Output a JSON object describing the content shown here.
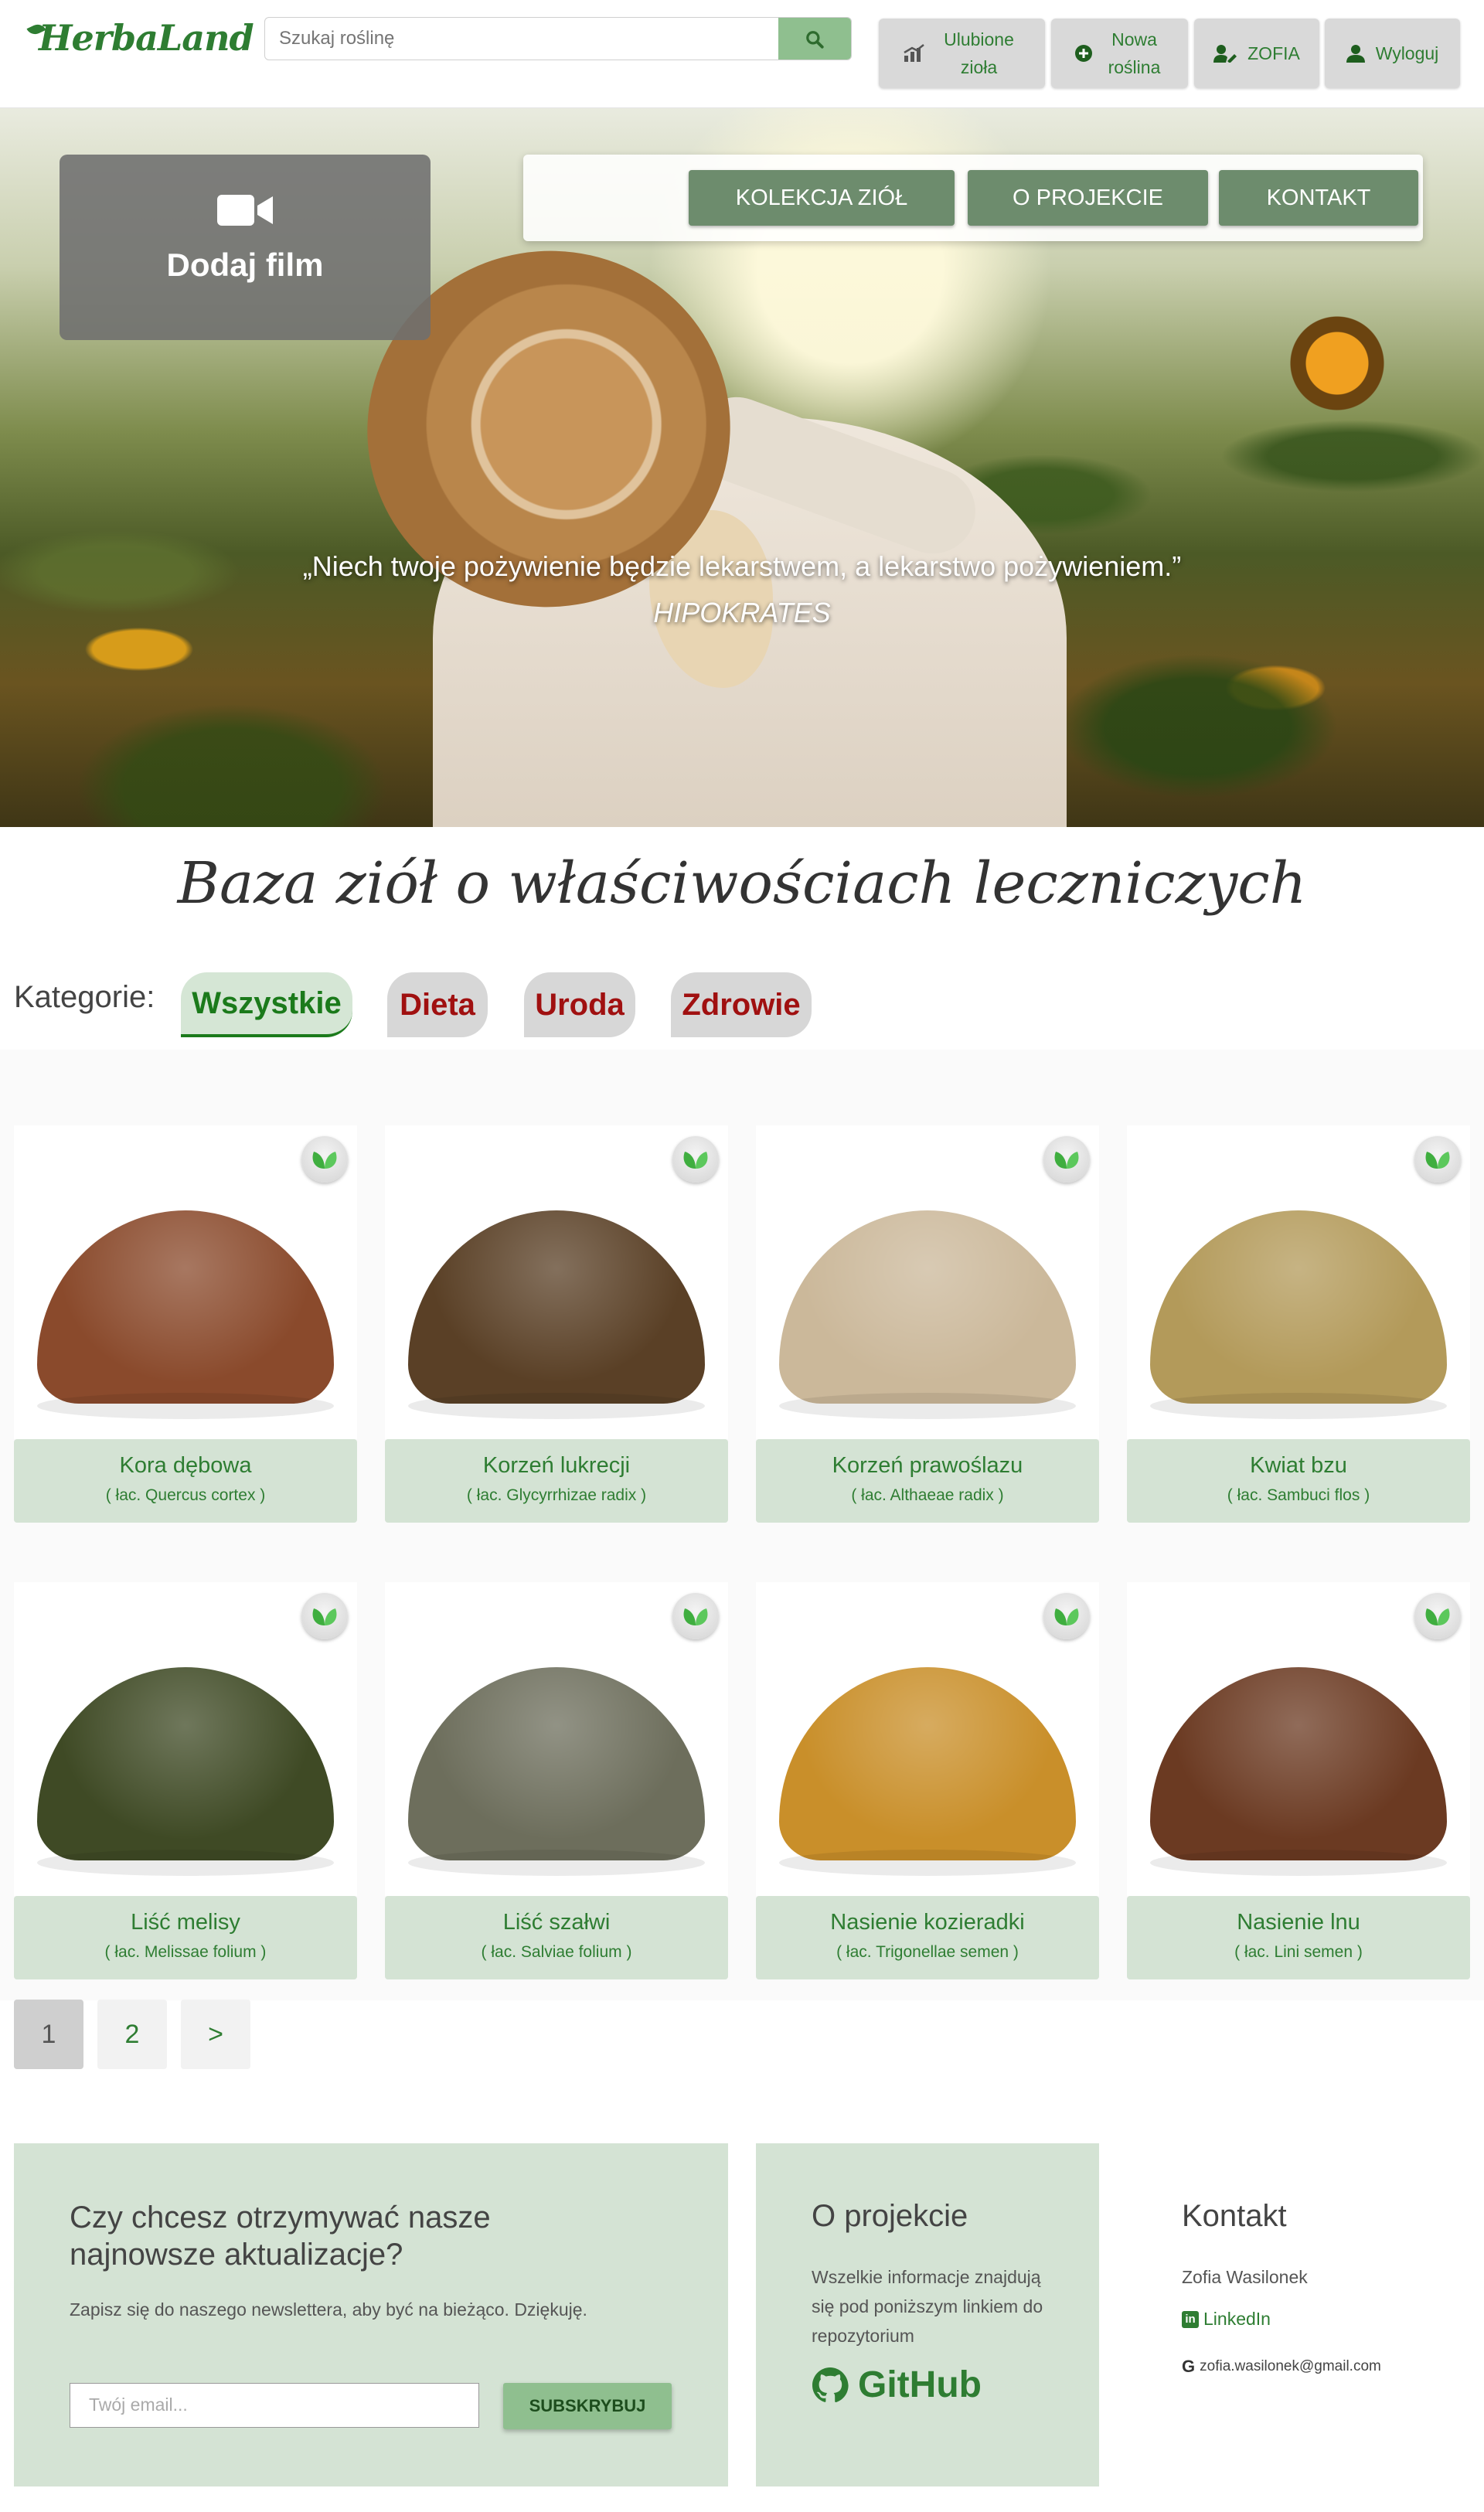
{
  "header": {
    "logo": "HerbaLand",
    "search_placeholder": "Szukaj roślinę",
    "buttons": {
      "favorites": "Ulubione zioła",
      "new_plant": "Nowa roślina",
      "user": "ZOFIA",
      "logout": "Wyloguj"
    }
  },
  "hero": {
    "video_button": "Dodaj film",
    "nav": [
      "KOLEKCJA ZIÓŁ",
      "O PROJEKCIE",
      "KONTAKT"
    ],
    "quote": "„Niech twoje pożywienie będzie lekarstwem, a lekarstwo pożywieniem.”",
    "author": "HIPOKRATES"
  },
  "section_title": "Baza ziół o właściwościach leczniczych",
  "categories": {
    "label": "Kategorie:",
    "items": [
      "Wszystkie",
      "Dieta",
      "Uroda",
      "Zdrowie"
    ],
    "active": "Wszystkie"
  },
  "plants": [
    {
      "name": "Kora dębowa",
      "latin": "( łac. Quercus cortex )",
      "color": "#8a4a2c"
    },
    {
      "name": "Korzeń lukrecji",
      "latin": "( łac. Glycyrrhizae radix )",
      "color": "#5a4026"
    },
    {
      "name": "Korzeń prawoślazu",
      "latin": "( łac. Althaeae radix )",
      "color": "#cbb89a"
    },
    {
      "name": "Kwiat bzu",
      "latin": "( łac. Sambuci flos )",
      "color": "#b39a5a"
    },
    {
      "name": "Liść melisy",
      "latin": "( łac. Melissae folium )",
      "color": "#3f4a25"
    },
    {
      "name": "Liść szałwi",
      "latin": "( łac. Salviae folium )",
      "color": "#6d6e5c"
    },
    {
      "name": "Nasienie kozieradki",
      "latin": "( łac. Trigonellae semen )",
      "color": "#c98f2a"
    },
    {
      "name": "Nasienie lnu",
      "latin": "( łac. Lini semen )",
      "color": "#6b3a22"
    }
  ],
  "pagination": [
    "1",
    "2",
    ">"
  ],
  "footer": {
    "newsletter": {
      "title": "Czy chcesz otrzymywać nasze najnowsze aktualizacje?",
      "text": "Zapisz się do naszego newslettera, aby być na bieżąco. Dziękuję.",
      "email_placeholder": "Twój email...",
      "button": "SUBSKRYBUJ"
    },
    "about": {
      "title": "O projekcie",
      "text": "Wszelkie informacje znajdują się pod poniższym linkiem do repozytorium",
      "github": "GitHub"
    },
    "contact": {
      "title": "Kontakt",
      "name": "Zofia Wasilonek",
      "linkedin": "LinkedIn",
      "email": "zofia.wasilonek@gmail.com"
    }
  }
}
